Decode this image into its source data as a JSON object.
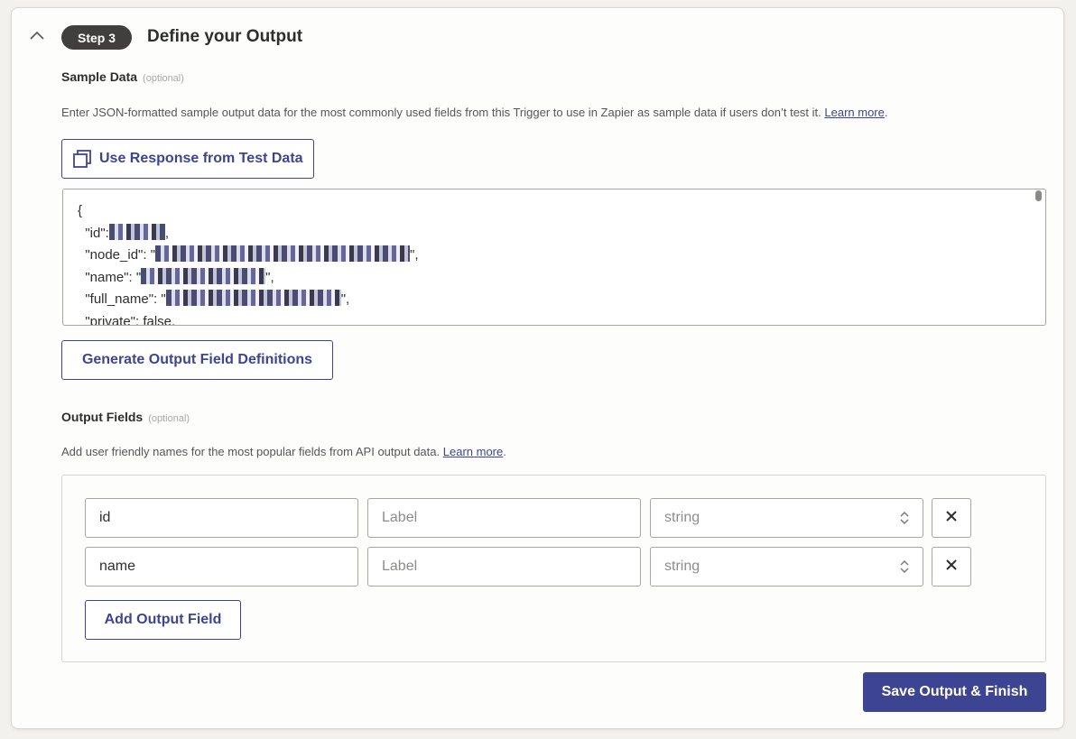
{
  "header": {
    "step_badge": "Step 3",
    "title": "Define your Output"
  },
  "sample_data": {
    "label": "Sample Data",
    "optional": "(optional)",
    "description": "Enter JSON-formatted sample output data for the most commonly used fields from this Trigger to use in Zapier as sample data if users don’t test it.",
    "learn_more": "Learn more",
    "use_response_button": "Use Response from Test Data",
    "json_lines": [
      "{",
      "  \"id\":",
      "  \"node_id\": \"",
      "  \"name\": \"",
      "  \"full_name\": \"",
      "  \"private\": false,"
    ],
    "generate_button": "Generate Output Field Definitions"
  },
  "output_fields": {
    "label": "Output Fields",
    "optional": "(optional)",
    "description": "Add user friendly names for the most popular fields from API output data.",
    "learn_more": "Learn more",
    "label_placeholder": "Label",
    "rows": [
      {
        "key": "id",
        "type": "string"
      },
      {
        "key": "name",
        "type": "string"
      }
    ],
    "add_button": "Add Output Field"
  },
  "footer": {
    "save_button": "Save Output & Finish"
  },
  "colors": {
    "accent": "#3d4592",
    "badge_bg": "#403f3e"
  }
}
